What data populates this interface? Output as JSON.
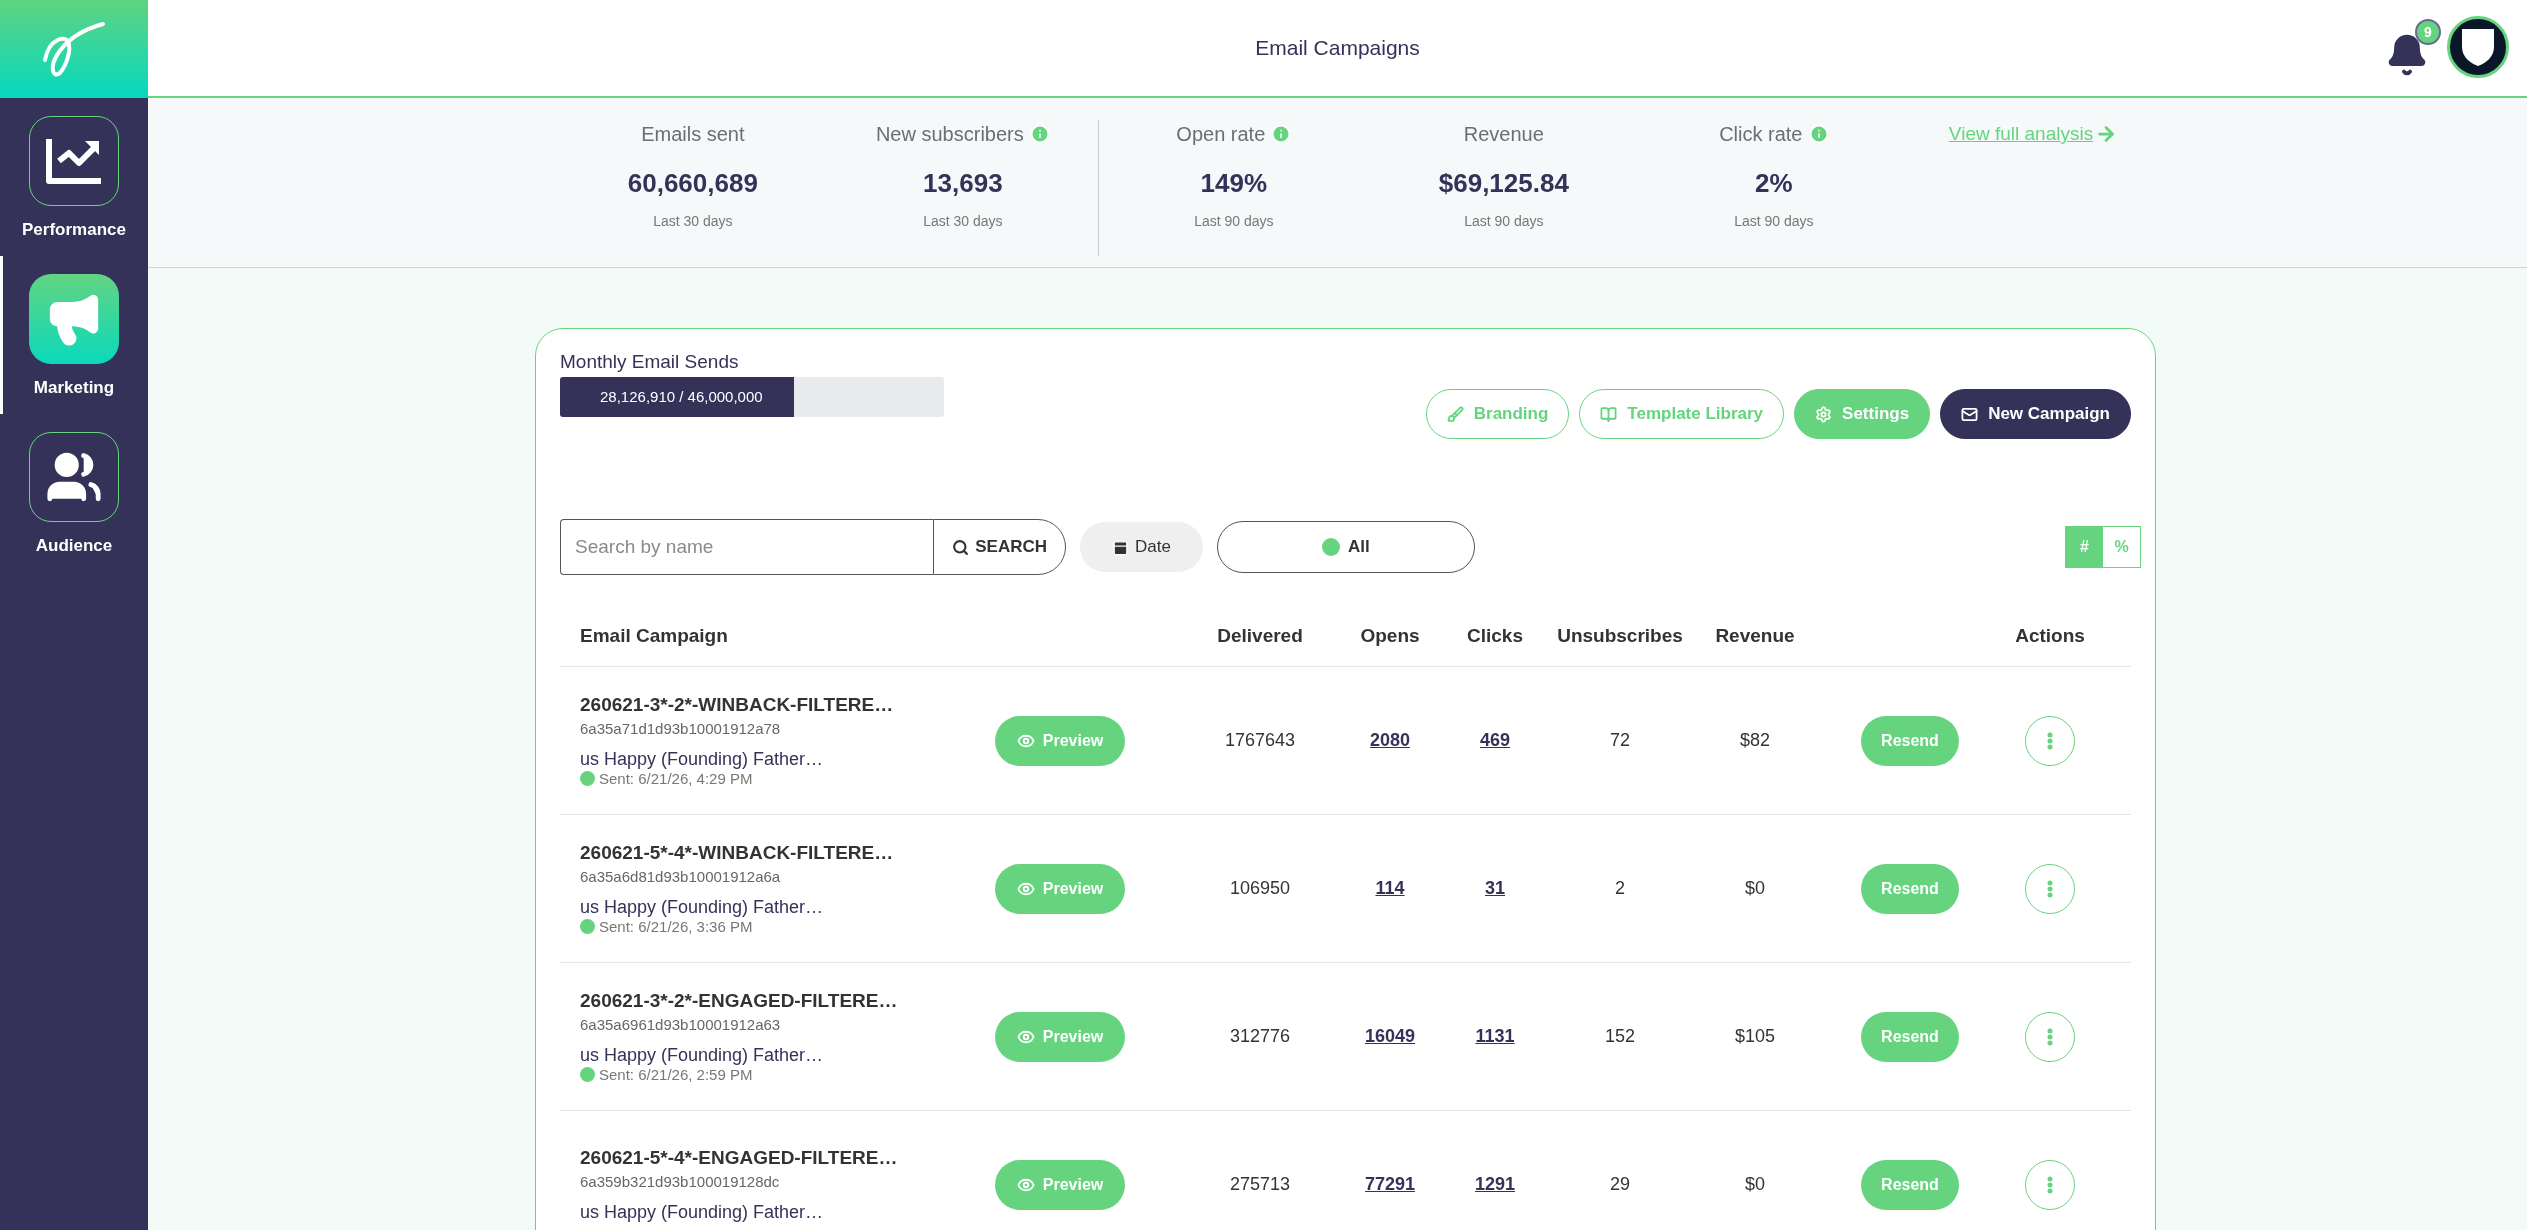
{
  "header": {
    "title": "Email Campaigns",
    "notification_count": "9"
  },
  "sidebar": {
    "items": [
      {
        "label": "Performance",
        "selected": false
      },
      {
        "label": "Marketing",
        "selected": true
      },
      {
        "label": "Audience",
        "selected": false
      }
    ]
  },
  "stats": {
    "groups": [
      [
        {
          "label": "Emails sent",
          "info": false,
          "value": "60,660,689",
          "period": "Last 30 days"
        },
        {
          "label": "New subscribers",
          "info": true,
          "value": "13,693",
          "period": "Last 30 days"
        }
      ],
      [
        {
          "label": "Open rate",
          "info": true,
          "value": "149%",
          "period": "Last 90 days"
        },
        {
          "label": "Revenue",
          "info": false,
          "value": "$69,125.84",
          "period": "Last 90 days"
        },
        {
          "label": "Click rate",
          "info": true,
          "value": "2%",
          "period": "Last 90 days"
        }
      ]
    ],
    "link": "View full analysis"
  },
  "sends": {
    "title": "Monthly Email Sends",
    "reading": "28,126,910 / 46,000,000",
    "level": 0.61
  },
  "toolbar": [
    {
      "label": "Branding",
      "kind": "outline"
    },
    {
      "label": "Template Library",
      "kind": "outline"
    },
    {
      "label": "Settings",
      "kind": "filled"
    },
    {
      "label": "New Campaign",
      "kind": "dark"
    }
  ],
  "filters": {
    "search": {
      "placeholder": "Search by name",
      "button": "SEARCH"
    },
    "date": "Date",
    "status": {
      "label": "All",
      "color": "#66d47e"
    },
    "view_toggle": [
      {
        "label": "#",
        "selected": true
      },
      {
        "label": "%",
        "selected": false
      }
    ]
  },
  "table": {
    "columns": [
      "Email Campaign",
      "Delivered",
      "Opens",
      "Clicks",
      "Unsubscribes",
      "Revenue",
      "Actions"
    ],
    "rows": [
      {
        "name": "260621-3*-2*-WINBACK-FILTERE…",
        "id": "6a35a71d1d93b10001912a78",
        "subject": "us Happy (Founding) Father…",
        "sent": "Sent: 6/21/26, 4:29 PM",
        "color": "#66d47e",
        "preview": "Preview",
        "resend": "Resend",
        "delivered": "1767643",
        "opens": "2080",
        "clicks": "469",
        "unsubscribes": "72",
        "revenue": "$82"
      },
      {
        "name": "260621-5*-4*-WINBACK-FILTERE…",
        "id": "6a35a6d81d93b10001912a6a",
        "subject": "us Happy (Founding) Father…",
        "sent": "Sent: 6/21/26, 3:36 PM",
        "color": "#66d47e",
        "preview": "Preview",
        "resend": "Resend",
        "delivered": "106950",
        "opens": "114",
        "clicks": "31",
        "unsubscribes": "2",
        "revenue": "$0"
      },
      {
        "name": "260621-3*-2*-ENGAGED-FILTERE…",
        "id": "6a35a6961d93b10001912a63",
        "subject": "us Happy (Founding) Father…",
        "sent": "Sent: 6/21/26, 2:59 PM",
        "color": "#66d47e",
        "preview": "Preview",
        "resend": "Resend",
        "delivered": "312776",
        "opens": "16049",
        "clicks": "1131",
        "unsubscribes": "152",
        "revenue": "$105"
      },
      {
        "name": "260621-5*-4*-ENGAGED-FILTERE…",
        "id": "6a359b321d93b100019128dc",
        "subject": "us Happy (Founding) Father…",
        "preview": "Preview",
        "resend": "Resend",
        "delivered": "275713",
        "opens": "77291",
        "clicks": "1291",
        "unsubscribes": "29",
        "revenue": "$0"
      }
    ]
  }
}
